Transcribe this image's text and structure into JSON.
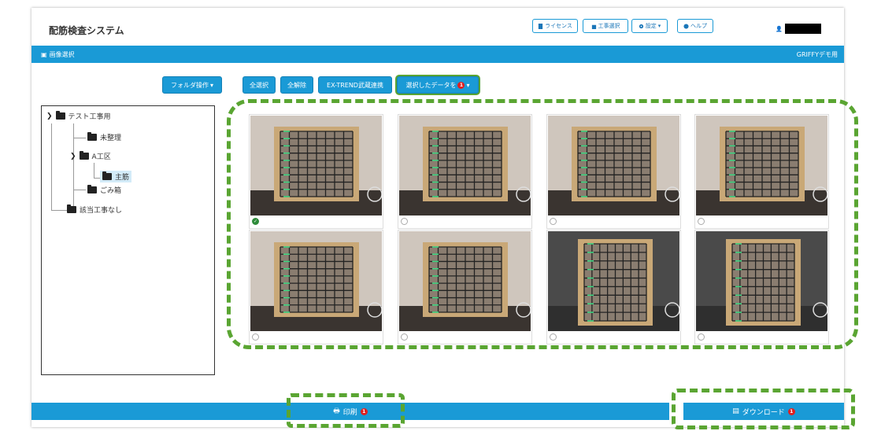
{
  "app": {
    "title": "配筋検査システム"
  },
  "top_buttons": [
    {
      "label": "ライセンス",
      "icon": "file-icon"
    },
    {
      "label": "工事選択",
      "icon": "building-icon"
    },
    {
      "label": "設定",
      "icon": "gear-icon"
    },
    {
      "label": "ヘルプ",
      "icon": "question-circle-icon"
    }
  ],
  "section": {
    "title": "画像選択",
    "right": "GRIFFYデモ用"
  },
  "toolbar": {
    "folder_ops": "フォルダ操作",
    "select_all": "全選択",
    "deselect_all": "全解除",
    "ex_trend": "EX-TREND武蔵連携",
    "selected_data": "選択したデータを",
    "selected_count": "1"
  },
  "tree": {
    "root": "テスト工事用",
    "unsorted": "未整理",
    "area_a": "A工区",
    "main_bar": "主筋",
    "trash": "ごみ箱",
    "none": "該当工事なし"
  },
  "images": [
    {
      "checked": true
    },
    {
      "checked": false
    },
    {
      "checked": false
    },
    {
      "checked": false
    },
    {
      "checked": false
    },
    {
      "checked": false
    },
    {
      "checked": false
    },
    {
      "checked": false
    }
  ],
  "footer": {
    "print_label": "印刷",
    "print_count": "1",
    "download_label": "ダウンロード",
    "download_count": "1"
  },
  "colors": {
    "accent": "#1a9ad6",
    "annotation": "#5aa532",
    "badge": "#e02020"
  }
}
